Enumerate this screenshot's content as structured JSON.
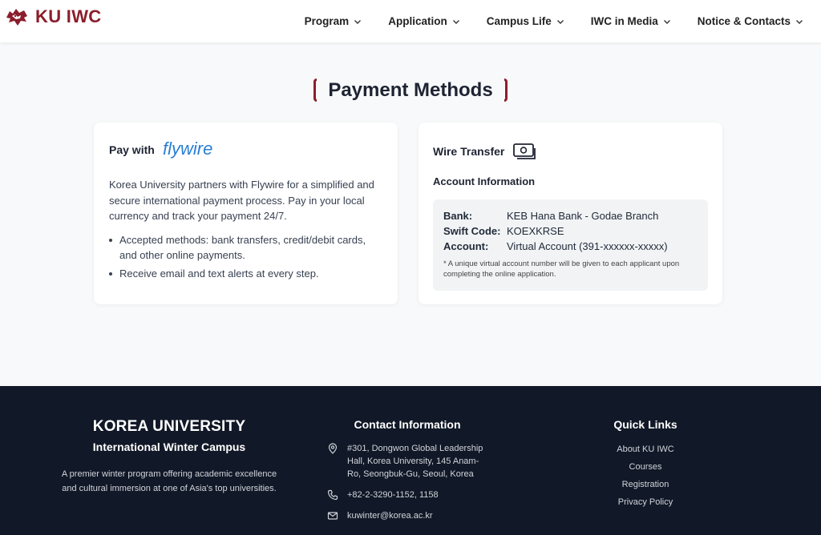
{
  "header": {
    "logo_text": "KU IWC",
    "nav": [
      {
        "label": "Program"
      },
      {
        "label": "Application"
      },
      {
        "label": "Campus Life"
      },
      {
        "label": "IWC in Media"
      },
      {
        "label": "Notice & Contacts"
      }
    ]
  },
  "page": {
    "title": "Payment Methods"
  },
  "flywire_card": {
    "pay_with": "Pay with",
    "logo_word": "flywire",
    "description": "Korea University partners with Flywire for a simplified and secure international payment process. Pay in your local currency and track your payment 24/7.",
    "bullets": [
      "Accepted methods: bank transfers, credit/debit cards, and other online payments.",
      "Receive email and text alerts at every step."
    ]
  },
  "wire_card": {
    "title": "Wire Transfer",
    "icon": "money-icon",
    "account_info_label": "Account Information",
    "rows": [
      {
        "key": "Bank:",
        "value": "KEB Hana Bank - Godae Branch"
      },
      {
        "key": "Swift Code:",
        "value": "KOEXKRSE"
      },
      {
        "key": "Account:",
        "value": "Virtual Account (391-xxxxxx-xxxxx)"
      }
    ],
    "note": "* A unique virtual account number will be given to each applicant upon completing the online application."
  },
  "footer": {
    "university": "KOREA UNIVERSITY",
    "campus": "International Winter Campus",
    "description": "A premier winter program offering academic excellence and cultural immersion at one of Asia's top universities.",
    "contact_heading": "Contact Information",
    "address": "#301, Dongwon Global Leadership Hall, Korea University, 145 Anam-Ro, Seongbuk-Gu, Seoul, Korea",
    "phone": "+82-2-3290-1152, 1158",
    "email": "kuwinter@korea.ac.kr",
    "quick_links_heading": "Quick Links",
    "quick_links": [
      {
        "label": "About KU IWC"
      },
      {
        "label": "Courses"
      },
      {
        "label": "Registration"
      },
      {
        "label": "Privacy Policy"
      }
    ]
  },
  "colors": {
    "brand": "#8b1e2c",
    "footer_bg": "#111827",
    "flywire_blue": "#2a7fd4"
  }
}
